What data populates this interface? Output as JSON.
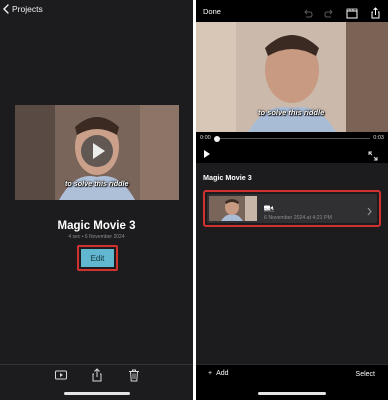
{
  "left": {
    "back_label": "Projects",
    "video_caption": "to solve this riddle",
    "project_title": "Magic Movie 3",
    "project_meta": "4 sec • 6 November 2024",
    "edit_label": "Edit",
    "toolbar": [
      "play-icon",
      "share-icon",
      "trash-icon"
    ]
  },
  "right": {
    "done_label": "Done",
    "top_icons": [
      "undo-icon",
      "redo-icon",
      "clapper-icon",
      "share-icon"
    ],
    "video_caption": "to solve this riddle",
    "time_current": "0:00",
    "time_total": "0:03",
    "section_title": "Magic Movie 3",
    "clip": {
      "duration": "0:03",
      "date": "6 November 2024 at 4:21 PM"
    },
    "add_label": "Add",
    "select_label": "Select"
  },
  "colors": {
    "highlight": "#d0332f",
    "edit_button": "#62b7d0",
    "panel_bg": "#1c1c1e"
  }
}
